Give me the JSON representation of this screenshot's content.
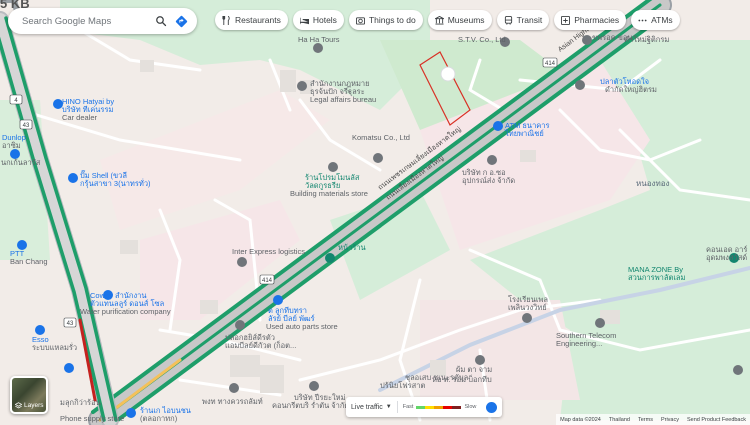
{
  "search": {
    "placeholder": "Search Google Maps"
  },
  "chips": [
    {
      "label": "Restaurants",
      "icon": "fork-knife-icon"
    },
    {
      "label": "Hotels",
      "icon": "bed-icon"
    },
    {
      "label": "Things to do",
      "icon": "camera-icon"
    },
    {
      "label": "Museums",
      "icon": "museum-icon"
    },
    {
      "label": "Transit",
      "icon": "transit-icon"
    },
    {
      "label": "Pharmacies",
      "icon": "pharmacy-icon"
    },
    {
      "label": "ATMs",
      "icon": "more-dots-icon"
    }
  ],
  "layers": {
    "label": "Layers"
  },
  "traffic": {
    "label": "Live traffic",
    "fast": "Fast",
    "slow": "Slow",
    "colors": [
      "#63d668",
      "#ffdd00",
      "#f1a000",
      "#e60000",
      "#811f1f"
    ]
  },
  "footer": {
    "map_data": "Map data ©2024",
    "country": "Thailand",
    "terms": "Terms",
    "privacy": "Privacy",
    "feedback": "Send Product Feedback"
  },
  "corner_text": "5 KB",
  "places": {
    "hatyai": "HINO Hatyai by",
    "hatyai_th": "บริษัท ทีเค่นรรม",
    "car_dealer": "Car dealer",
    "shell": "ปั๊ม Shell (ขวลี",
    "shell2": "กรุ้นสาขา 3(นาทรทั่ว)",
    "shell3": "นกเก้นลารัส",
    "dunlop": "Dunlop",
    "dunlop2": "อาซิม",
    "hahatours": "Ha Ha Tours",
    "office": "สำนักงานกฎหมาย",
    "office2": "ธุรจ้นปัก จรีฐุลระ",
    "office3": "Legal affairs bureau",
    "komatsu": "Komatsu Co., Ltd",
    "building": "ร้านโปรมโมนลัส",
    "building2": "วัลดกูรธรีย",
    "building3": "Building materials store",
    "stv": "S.T.V. Co., Ltd",
    "atm": "ATM ธนาคาร",
    "atm2": "ไทยพาณิชย์",
    "company": "บริษัท ก อ.ซอ",
    "company2": "อุปกรณ์ส่ง จ้ากัด",
    "inter": "Inter Express logistics",
    "shop": "หน้าร้าน",
    "coway": "Coway สำนักงาน",
    "coway2": "ตัวแทนลลูร์ ดอนส์ โซล",
    "coway3": "Water purification company",
    "esso": "Esso",
    "esso2": "ระบบแหลมรั่ว",
    "ptt": "PTT",
    "ptt2": "Ban Chang",
    "used": "ต ลูกทีบทรา",
    "used2": "ลัรย์ บีลย์ พัฒร์",
    "used3": "Used auto parts store",
    "toyota": "ปลอกฮยิส์ดีรตัว",
    "toyota2": "แอมบีลย์ดีกัวต (ก็อต...",
    "mana": "MANA ZONE By",
    "mana2": "สวนการพาลัตเลม",
    "southern": "Southern Telecom",
    "southern2": "Engineering...",
    "right_top": "ขพรอค ขอน",
    "right_top2": "ปลาตัวโหอดใจ",
    "right_top3": "คำใหม่ฐิติกรม",
    "school": "โรงเรียนเพล",
    "school2": "เพลินวงวิทย์",
    "bottom1": "ผ้ม ตา จาม",
    "bottom2": "บริษัท ปีรยะใหม่",
    "bottom3": "คอนกรีตบริ ร่ำตัน จ้ากัด",
    "bottom4": "ปร้นิยโฟรสาต",
    "bottom5": "พงท ทางควรถลัมท์",
    "bottom6": "หอ ท. รอม บ็อกทีบ",
    "bottom7": "ร้านเก ไอบนชน",
    "bottom8": "(ตลอกาทก)",
    "bottom9": "ชุลอเสบ ชเนะรตับล",
    "bottom10": "มลุกกิว่าร้อน",
    "bottom11": "Phone supply store",
    "rightmid": "คอนเอด อาร์",
    "rightmid2": "อุดมพงสวัสด์",
    "area": "หนองทอง",
    "area2": "ดำกัดใหญ่ฮิตรม",
    "highway_label": "ถนนเพชรเกษมเลี่ยงเมืองหาดใหญ่",
    "highway_label2": "ถนนเลี่ยงเมืองหาดใหญ่",
    "highway_label3": "Asian Highway",
    "route_num": "414",
    "route_num2": "414",
    "route_num3": "43",
    "route_num4": "43",
    "route_num5": "4"
  }
}
